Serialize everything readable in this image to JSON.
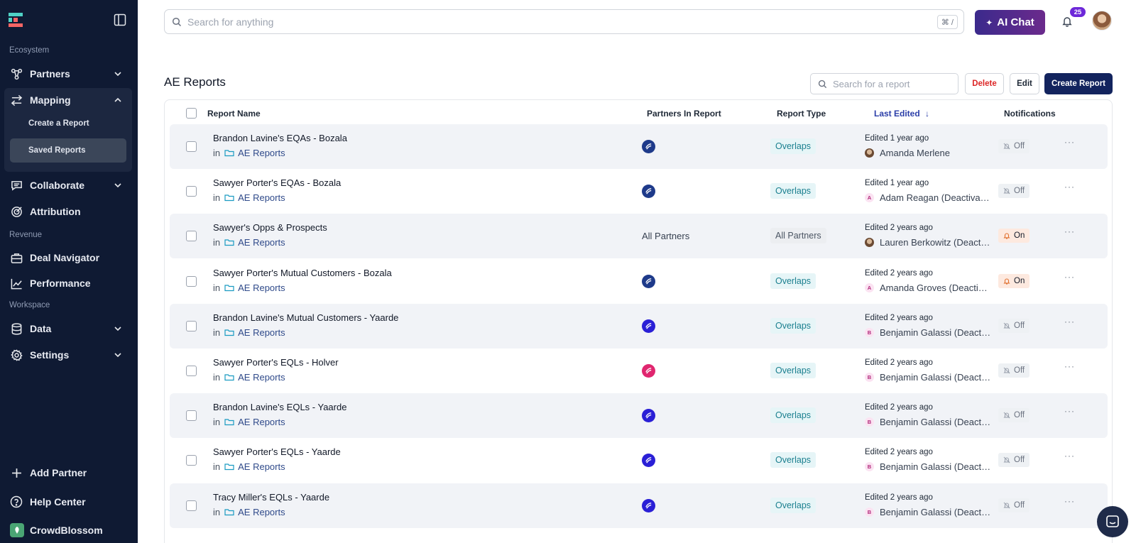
{
  "sidebar": {
    "sections": {
      "ecosystem": "Ecosystem",
      "revenue": "Revenue",
      "workspace": "Workspace"
    },
    "items": {
      "partners": "Partners",
      "mapping": "Mapping",
      "create_report": "Create a Report",
      "saved_reports": "Saved Reports",
      "collaborate": "Collaborate",
      "attribution": "Attribution",
      "deal_navigator": "Deal Navigator",
      "performance": "Performance",
      "data": "Data",
      "settings": "Settings"
    },
    "bottom": {
      "add_partner": "Add Partner",
      "help_center": "Help Center",
      "org": "CrowdBlossom"
    }
  },
  "topbar": {
    "search_placeholder": "Search for anything",
    "shortcut": "⌘ /",
    "ai_chat": "AI Chat",
    "notification_count": "25"
  },
  "page": {
    "title": "AE Reports",
    "report_search_placeholder": "Search for a report",
    "delete": "Delete",
    "edit": "Edit",
    "create": "Create Report"
  },
  "table": {
    "columns": {
      "name": "Report Name",
      "partners": "Partners In Report",
      "type": "Report Type",
      "edited": "Last Edited",
      "sort_arrow": "↓",
      "notifications": "Notifications"
    },
    "folder_prefix": "in",
    "rows": [
      {
        "name": "Brandon Lavine's EQAs - Bozala",
        "folder": "AE Reports",
        "partner": "bozala",
        "partner_text": "",
        "type": "Overlaps",
        "type_style": "overlaps",
        "edited": "Edited 1 year ago",
        "editor": "Amanda Merlene",
        "editor_initial": "",
        "editor_avatar": "photo",
        "notif": "Off"
      },
      {
        "name": "Sawyer Porter's EQAs - Bozala",
        "folder": "AE Reports",
        "partner": "bozala",
        "partner_text": "",
        "type": "Overlaps",
        "type_style": "overlaps",
        "edited": "Edited 1 year ago",
        "editor": "Adam Reagan (Deactivated)",
        "editor_initial": "A",
        "editor_avatar": "initial",
        "notif": "Off"
      },
      {
        "name": "Sawyer's Opps & Prospects",
        "folder": "AE Reports",
        "partner": "",
        "partner_text": "All Partners",
        "type": "All Partners",
        "type_style": "all",
        "edited": "Edited 2 years ago",
        "editor": "Lauren Berkowitz (Deactivated)",
        "editor_initial": "",
        "editor_avatar": "photo",
        "notif": "On"
      },
      {
        "name": "Sawyer Porter's Mutual Customers - Bozala",
        "folder": "AE Reports",
        "partner": "bozala",
        "partner_text": "",
        "type": "Overlaps",
        "type_style": "overlaps",
        "edited": "Edited 2 years ago",
        "editor": "Amanda Groves (Deactivated)",
        "editor_initial": "A",
        "editor_avatar": "initial",
        "notif": "On"
      },
      {
        "name": "Brandon Lavine's Mutual Customers - Yaarde",
        "folder": "AE Reports",
        "partner": "yaarde",
        "partner_text": "",
        "type": "Overlaps",
        "type_style": "overlaps",
        "edited": "Edited 2 years ago",
        "editor": "Benjamin Galassi (Deactivated)",
        "editor_initial": "B",
        "editor_avatar": "initial",
        "notif": "Off"
      },
      {
        "name": "Sawyer Porter's EQLs - Holver",
        "folder": "AE Reports",
        "partner": "holver",
        "partner_text": "",
        "type": "Overlaps",
        "type_style": "overlaps",
        "edited": "Edited 2 years ago",
        "editor": "Benjamin Galassi (Deactivated)",
        "editor_initial": "B",
        "editor_avatar": "initial",
        "notif": "Off"
      },
      {
        "name": "Brandon Lavine's EQLs - Yaarde",
        "folder": "AE Reports",
        "partner": "yaarde",
        "partner_text": "",
        "type": "Overlaps",
        "type_style": "overlaps",
        "edited": "Edited 2 years ago",
        "editor": "Benjamin Galassi (Deactivated)",
        "editor_initial": "B",
        "editor_avatar": "initial",
        "notif": "Off"
      },
      {
        "name": "Sawyer Porter's EQLs - Yaarde",
        "folder": "AE Reports",
        "partner": "yaarde",
        "partner_text": "",
        "type": "Overlaps",
        "type_style": "overlaps",
        "edited": "Edited 2 years ago",
        "editor": "Benjamin Galassi (Deactivated)",
        "editor_initial": "B",
        "editor_avatar": "initial",
        "notif": "Off"
      },
      {
        "name": "Tracy Miller's EQLs - Yaarde",
        "folder": "AE Reports",
        "partner": "yaarde",
        "partner_text": "",
        "type": "Overlaps",
        "type_style": "overlaps",
        "edited": "Edited 2 years ago",
        "editor": "Benjamin Galassi (Deactivated)",
        "editor_initial": "B",
        "editor_avatar": "initial",
        "notif": "Off"
      }
    ]
  },
  "colors": {
    "sidebar_bg": "#0f1a33",
    "primary_button": "#13245e",
    "delete": "#dc2626",
    "overlaps_badge": "#1a7f8f",
    "bozala": "#1e3a8a",
    "yaarde": "#2a1fd6",
    "holver": "#e0266f"
  }
}
